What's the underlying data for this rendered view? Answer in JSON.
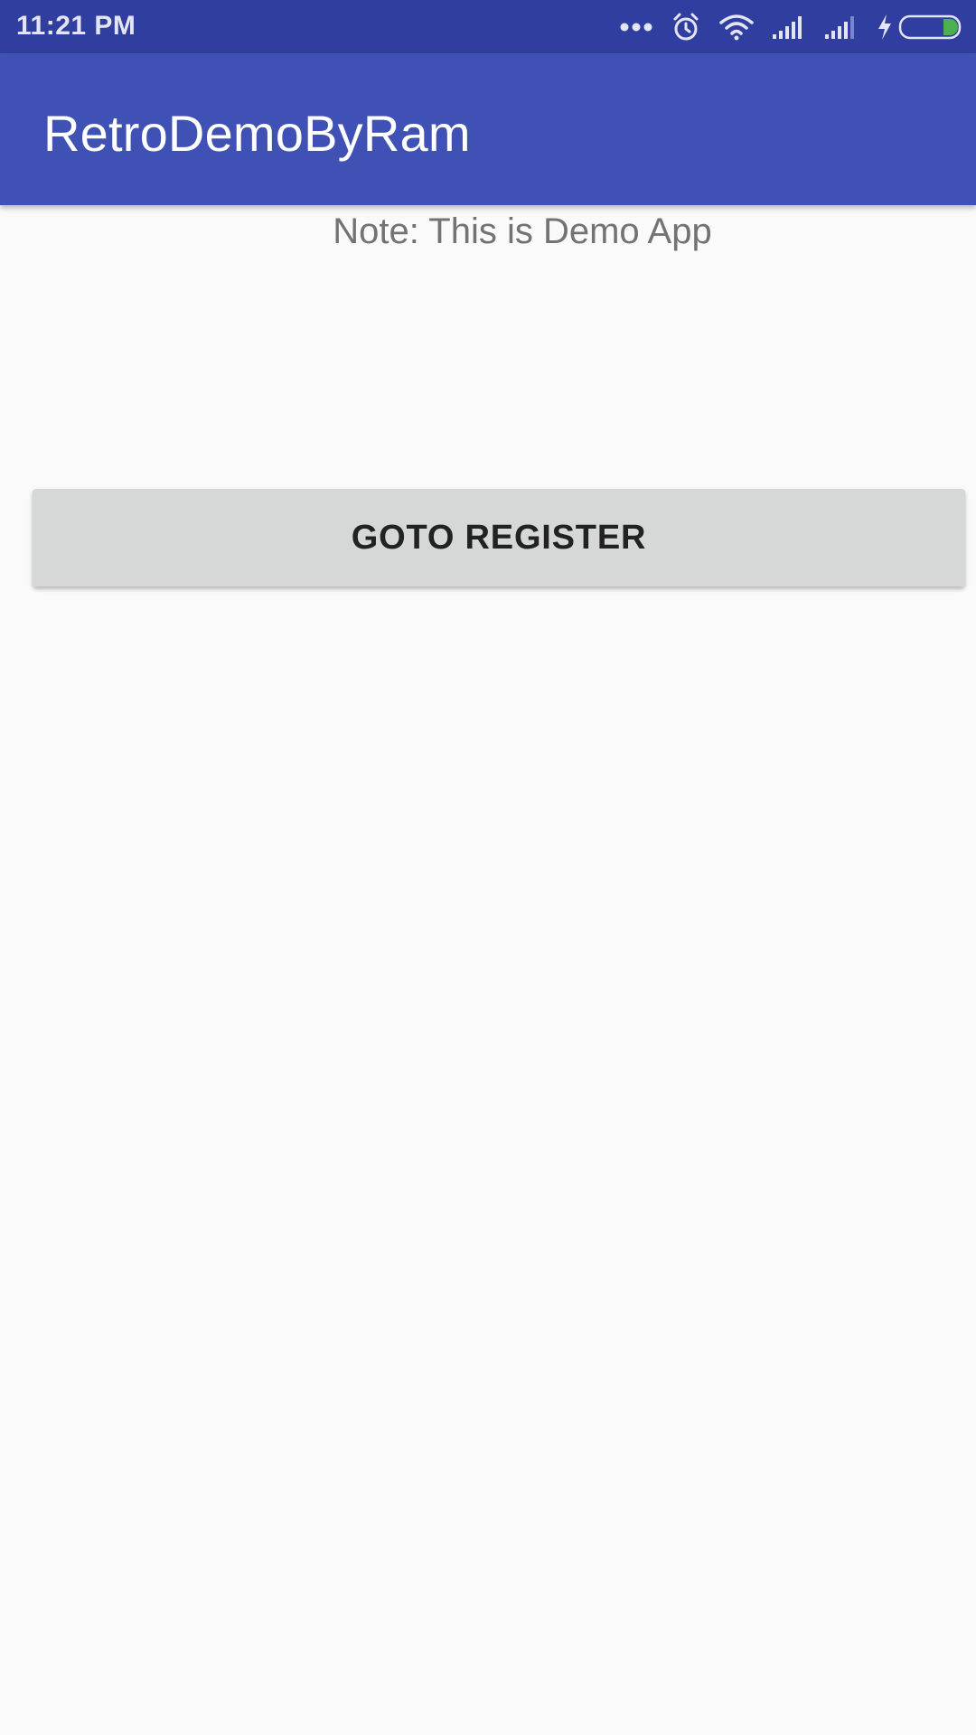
{
  "status_bar": {
    "time": "11:21 PM",
    "icons": [
      "more-dots-icon",
      "alarm-icon",
      "wifi-icon",
      "signal-icon",
      "signal-icon",
      "charging-bolt-icon",
      "battery-icon"
    ],
    "background_color": "#303f9f",
    "battery_level_color": "#4caf50"
  },
  "app_bar": {
    "title": "RetroDemoByRam",
    "background_color": "#3f51b5"
  },
  "main": {
    "note": "Note: This is Demo App",
    "goto_register_label": "GOTO REGISTER"
  }
}
